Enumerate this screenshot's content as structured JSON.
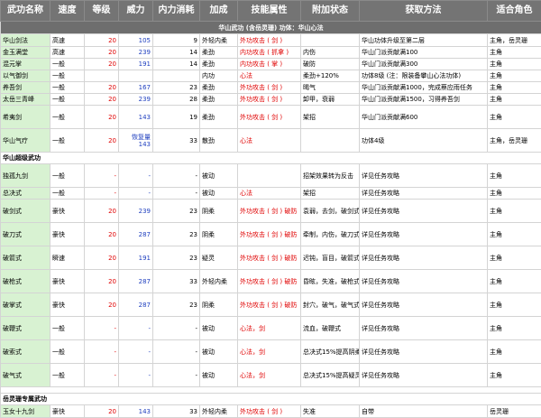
{
  "headers": [
    "武功名称",
    "速度",
    "等级",
    "威力",
    "内力消耗",
    "加成",
    "技能属性",
    "附加状态",
    "获取方法",
    "适合角色"
  ],
  "banner": "华山武功 (含岳灵珊) 功体：华山心法",
  "section_super": "华山超级武功",
  "section_exclusive": "岳灵珊专属武功",
  "rows_a": [
    {
      "name": "华山剑法",
      "speed": "高速",
      "level": "20",
      "power": "105",
      "cost": "9",
      "bonus": "外轻内柔",
      "attr": "外功攻击 ( 剑 )",
      "status": "",
      "source": "华山功体升级至第二层",
      "role": "主角，岳灵珊"
    },
    {
      "name": "金玉满堂",
      "speed": "高速",
      "level": "20",
      "power": "239",
      "cost": "14",
      "bonus": "柔劲",
      "attr": "内功攻击 ( 抓拿 )",
      "status": "内伤",
      "source": "华山门派贡献满100",
      "role": "主角"
    },
    {
      "name": "混元掌",
      "speed": "一般",
      "level": "20",
      "power": "191",
      "cost": "14",
      "bonus": "柔劲",
      "attr": "内功攻击 ( 掌 )",
      "status": "破防",
      "source": "华山门派贡献满300",
      "role": "主角"
    },
    {
      "name": "以气御剑",
      "speed": "一般",
      "level": "",
      "power": "",
      "cost": "",
      "bonus": "内功",
      "attr": "心法",
      "status": "柔劲+120%",
      "source": "功体8级 (注：限装备攀山心法功体)",
      "role": "主角"
    },
    {
      "name": "养吾剑",
      "speed": "一般",
      "level": "20",
      "power": "167",
      "cost": "23",
      "bonus": "柔劲",
      "attr": "外功攻击 ( 剑 )",
      "status": "暍气",
      "source": "华山门派贡献满1000，完成蔡应雨任务",
      "role": "主角"
    },
    {
      "name": "太岳三青峰",
      "speed": "一般",
      "level": "20",
      "power": "239",
      "cost": "28",
      "bonus": "柔劲",
      "attr": "外功攻击 ( 剑 )",
      "status": "卸甲，衰弱",
      "source": "华山门派贡献满1500，习得养吾剑",
      "role": "主角"
    },
    {
      "name": "希夷剑",
      "speed": "一般",
      "level": "20",
      "power": "143",
      "cost": "19",
      "bonus": "柔劲",
      "attr": "外功攻击 ( 剑 )",
      "status": "架招",
      "source": "华山门派贡献满600",
      "role": "主角"
    },
    {
      "name": "华山气疗",
      "speed": "一般",
      "level": "20",
      "power": "恢复量\n143",
      "cost": "33",
      "bonus": "散劲",
      "attr": "心法",
      "status": "",
      "source": "功体4级",
      "role": "主角，岳灵珊"
    }
  ],
  "rows_b": [
    {
      "name": "独孤九剑",
      "speed": "一般",
      "level": "-",
      "power": "-",
      "cost": "-",
      "bonus": "被动",
      "attr": "",
      "status": "招架效果转为反击",
      "source": "详见任务攻略",
      "role": "主角"
    },
    {
      "name": "总决式",
      "speed": "一般",
      "level": "-",
      "power": "-",
      "cost": "-",
      "bonus": "被动",
      "attr": "心法",
      "status": "架招",
      "source": "详见任务攻略",
      "role": "主角"
    },
    {
      "name": "破剑式",
      "speed": "豪快",
      "level": "20",
      "power": "239",
      "cost": "23",
      "bonus": "阴柔",
      "attr": "外功攻击 ( 剑 ) 破防",
      "status": "袁弱，去剑，破剑式",
      "source": "详见任务攻略",
      "role": "主角"
    },
    {
      "name": "破刀式",
      "speed": "豪快",
      "level": "20",
      "power": "287",
      "cost": "23",
      "bonus": "阴柔",
      "attr": "外功攻击 ( 剑 ) 破防",
      "status": "牵制，内伤，破刀式",
      "source": "详见任务攻略",
      "role": "主角"
    },
    {
      "name": "破箭式",
      "speed": "瞬速",
      "level": "20",
      "power": "191",
      "cost": "23",
      "bonus": "疑灵",
      "attr": "外功攻击 ( 剑 ) 破防",
      "status": "迟钝，盲目，破箭式",
      "source": "详见任务攻略",
      "role": "主角"
    },
    {
      "name": "破枪式",
      "speed": "豪快",
      "level": "20",
      "power": "287",
      "cost": "33",
      "bonus": "外轻内柔",
      "attr": "外功攻击 ( 剑 ) 破防",
      "status": "昏眩，失准，破枪式",
      "source": "详见任务攻略",
      "role": "主角"
    },
    {
      "name": "破掌式",
      "speed": "豪快",
      "level": "20",
      "power": "287",
      "cost": "23",
      "bonus": "阴柔",
      "attr": "外功攻击 ( 剑 ) 破防",
      "status": "封穴，破气，破气式",
      "source": "详见任务攻略",
      "role": "主角"
    },
    {
      "name": "破鞭式",
      "speed": "一般",
      "level": "-",
      "power": "-",
      "cost": "-",
      "bonus": "被动",
      "attr": "心法，剑",
      "status": "流血，破鞭式",
      "source": "详见任务攻略",
      "role": "主角"
    },
    {
      "name": "破索式",
      "speed": "一般",
      "level": "-",
      "power": "-",
      "cost": "-",
      "bonus": "被动",
      "attr": "心法，剑",
      "status": "总决式15%提高阴柔30%",
      "source": "详见任务攻略",
      "role": "主角"
    },
    {
      "name": "破气式",
      "speed": "一般",
      "level": "-",
      "power": "-",
      "cost": "-",
      "bonus": "被动",
      "attr": "心法，剑",
      "status": "总决式15%提高疑灵30%",
      "source": "详见任务攻略",
      "role": "主角"
    }
  ],
  "rows_c": [
    {
      "name": "玉女十九剑",
      "speed": "豪快",
      "level": "20",
      "power": "143",
      "cost": "33",
      "bonus": "外轻内柔",
      "attr": "外功攻击 ( 剑 )",
      "status": "失准",
      "source": "自带",
      "role": "岳灵珊"
    }
  ]
}
